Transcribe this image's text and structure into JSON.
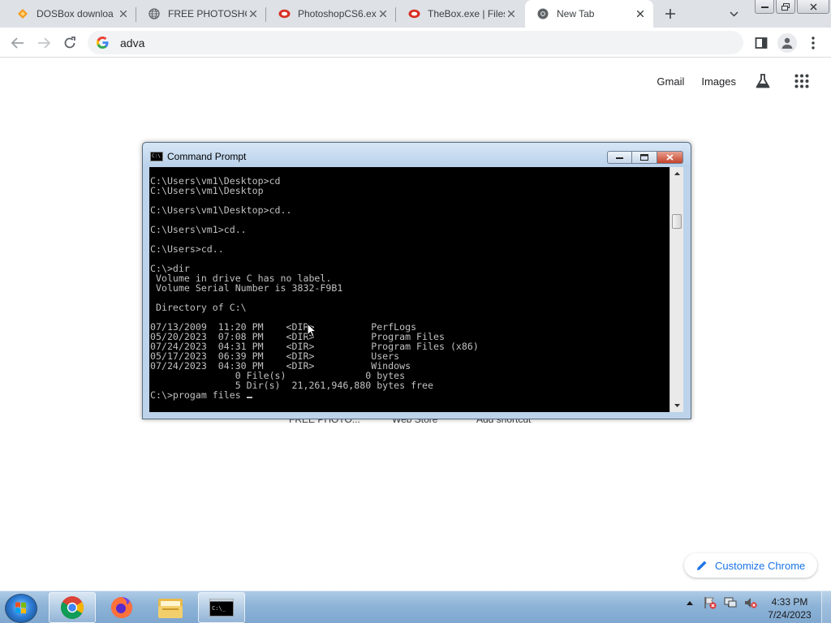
{
  "browser": {
    "tabs": [
      {
        "title": "DOSBox downloa",
        "icon": "dosbox-icon",
        "active": false
      },
      {
        "title": "FREE PHOTOSHO",
        "icon": "globe-icon",
        "active": false
      },
      {
        "title": "PhotoshopCS6.ex",
        "icon": "mediafire-icon",
        "active": false
      },
      {
        "title": "TheBox.exe | Files",
        "icon": "mediafire-icon",
        "active": false
      },
      {
        "title": "New Tab",
        "icon": "chrome-icon",
        "active": true
      }
    ],
    "omnibox_text": "adva"
  },
  "ntp": {
    "gmail_label": "Gmail",
    "images_label": "Images",
    "shortcuts": [
      "FREE PHOTO...",
      "Web Store",
      "Add shortcut"
    ],
    "customize_label": "Customize Chrome"
  },
  "cmd": {
    "title": "Command Prompt",
    "output": "C:\\Users\\vm1\\Desktop>cd\nC:\\Users\\vm1\\Desktop\n\nC:\\Users\\vm1\\Desktop>cd..\n\nC:\\Users\\vm1>cd..\n\nC:\\Users>cd..\n\nC:\\>dir\n Volume in drive C has no label.\n Volume Serial Number is 3832-F9B1\n\n Directory of C:\\\n\n07/13/2009  11:20 PM    <DIR>          PerfLogs\n05/20/2023  07:08 PM    <DIR>          Program Files\n07/24/2023  04:31 PM    <DIR>          Program Files (x86)\n05/17/2023  06:39 PM    <DIR>          Users\n07/24/2023  04:30 PM    <DIR>          Windows\n               0 File(s)              0 bytes\n               5 Dir(s)  21,261,946,880 bytes free\n",
    "prompt_line": "C:\\>progam files "
  },
  "taskbar": {
    "time": "4:33 PM",
    "date": "7/24/2023",
    "pinned": [
      "chrome-icon",
      "firefox-icon",
      "explorer-icon",
      "cmd-icon"
    ]
  },
  "colors": {
    "tabstrip_bg": "#dee1e6",
    "link_blue": "#1a73e8",
    "console_bg": "#000000",
    "console_fg": "#c0c0c0",
    "taskbar_bg": "#8db3d7"
  }
}
